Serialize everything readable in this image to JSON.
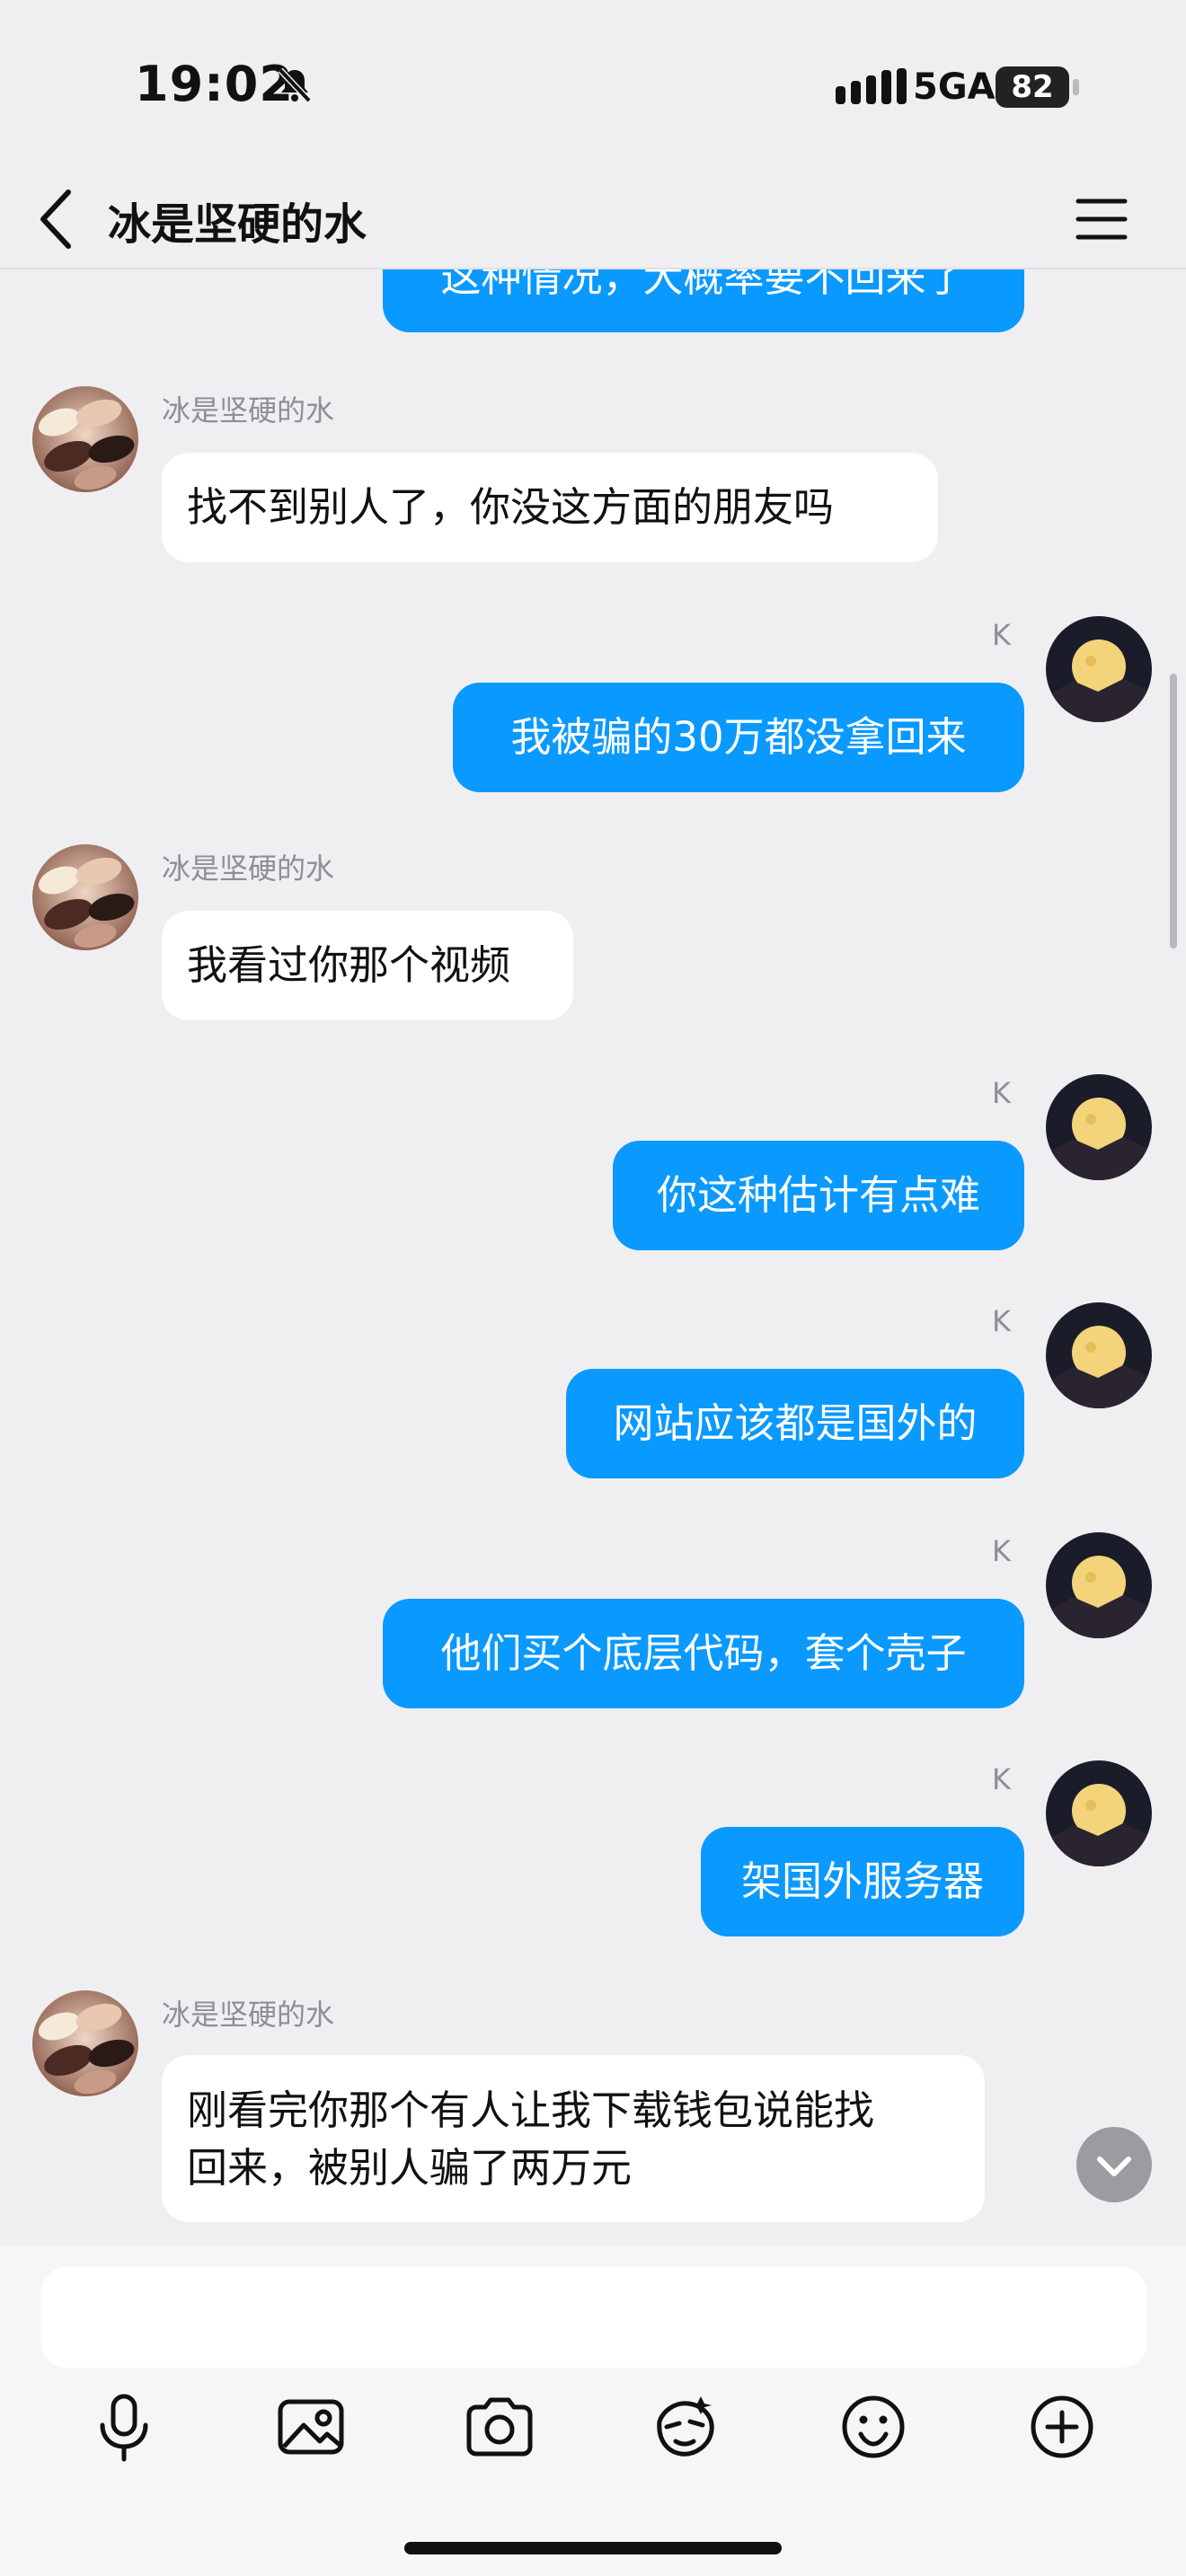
{
  "status_bar": {
    "time": "19:02",
    "network": "5GA",
    "battery": "82"
  },
  "nav": {
    "title": "冰是坚硬的水"
  },
  "messages": [
    {
      "dir": "out",
      "text": "这种情况，大概率要不回来了"
    },
    {
      "dir": "in",
      "sender": "冰是坚硬的水",
      "text": "找不到别人了，你没这方面的朋友吗"
    },
    {
      "dir": "out",
      "sender": "K",
      "text": "我被骗的30万都没拿回来"
    },
    {
      "dir": "in",
      "sender": "冰是坚硬的水",
      "text": "我看过你那个视频"
    },
    {
      "dir": "out",
      "sender": "K",
      "text": "你这种估计有点难"
    },
    {
      "dir": "out",
      "sender": "K",
      "text": "网站应该都是国外的"
    },
    {
      "dir": "out",
      "sender": "K",
      "text": "他们买个底层代码，套个壳子"
    },
    {
      "dir": "out",
      "sender": "K",
      "text": "架国外服务器"
    },
    {
      "dir": "in",
      "sender": "冰是坚硬的水",
      "text_line1": "刚看完你那个有人让我下载钱包说能找",
      "text_line2": "回来，被别人骗了两万元"
    }
  ],
  "composer": {
    "placeholder": "",
    "tools": [
      "microphone-icon",
      "image-icon",
      "camera-icon",
      "sticker-icon",
      "emoji-icon",
      "plus-icon"
    ]
  },
  "colors": {
    "outgoing_bubble": "#0a99ff",
    "incoming_bubble": "#ffffff",
    "background": "#efeff1"
  }
}
